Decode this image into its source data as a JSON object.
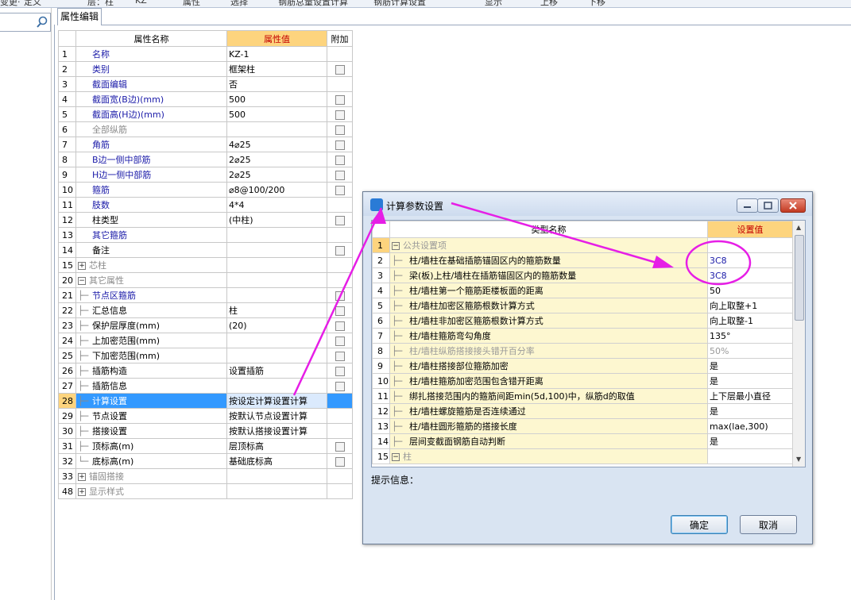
{
  "toolbar": {
    "items": [
      "变更·",
      "定义",
      "层：柱",
      "KZ",
      "属性",
      "选择",
      "钢筋总量设置计算",
      "钢筋计算设置",
      "显示",
      "上移",
      "下移"
    ]
  },
  "panel": {
    "tab_label": "属性编辑",
    "columns": {
      "name": "属性名称",
      "value": "属性值",
      "extra": "附加"
    },
    "rows": [
      {
        "num": "1",
        "name": "名称",
        "value": "KZ-1",
        "style": "blue",
        "check": false,
        "level": 0
      },
      {
        "num": "2",
        "name": "类别",
        "value": "框架柱",
        "style": "blue",
        "check": true,
        "level": 0
      },
      {
        "num": "3",
        "name": "截面编辑",
        "value": "否",
        "style": "blue",
        "check": false,
        "level": 0
      },
      {
        "num": "4",
        "name": "截面宽(B边)(mm)",
        "value": "500",
        "style": "blue",
        "check": true,
        "level": 0
      },
      {
        "num": "5",
        "name": "截面高(H边)(mm)",
        "value": "500",
        "style": "blue",
        "check": true,
        "level": 0
      },
      {
        "num": "6",
        "name": "全部纵筋",
        "value": "",
        "style": "gray",
        "check": true,
        "level": 0
      },
      {
        "num": "7",
        "name": "角筋",
        "value": "4⌀25",
        "style": "blue",
        "check": true,
        "level": 0
      },
      {
        "num": "8",
        "name": "B边一侧中部筋",
        "value": "2⌀25",
        "style": "blue",
        "check": true,
        "level": 0
      },
      {
        "num": "9",
        "name": "H边一侧中部筋",
        "value": "2⌀25",
        "style": "blue",
        "check": true,
        "level": 0
      },
      {
        "num": "10",
        "name": "箍筋",
        "value": "⌀8@100/200",
        "style": "blue",
        "check": true,
        "level": 0
      },
      {
        "num": "11",
        "name": "肢数",
        "value": "4*4",
        "style": "blue",
        "check": false,
        "level": 0
      },
      {
        "num": "12",
        "name": "柱类型",
        "value": "(中柱)",
        "style": "black",
        "check": true,
        "level": 0
      },
      {
        "num": "13",
        "name": "其它箍筋",
        "value": "",
        "style": "blue",
        "check": false,
        "level": 0
      },
      {
        "num": "14",
        "name": "备注",
        "value": "",
        "style": "black",
        "check": true,
        "level": 0
      },
      {
        "num": "15",
        "name": "芯柱",
        "value": "",
        "style": "gray",
        "check": false,
        "level": 0,
        "expander": "+"
      },
      {
        "num": "20",
        "name": "其它属性",
        "value": "",
        "style": "gray",
        "check": false,
        "level": 0,
        "expander": "−"
      },
      {
        "num": "21",
        "name": "节点区箍筋",
        "value": "",
        "style": "blue",
        "check": true,
        "level": 1
      },
      {
        "num": "22",
        "name": "汇总信息",
        "value": "柱",
        "style": "black",
        "check": true,
        "level": 1
      },
      {
        "num": "23",
        "name": "保护层厚度(mm)",
        "value": "(20)",
        "style": "black",
        "check": true,
        "level": 1
      },
      {
        "num": "24",
        "name": "上加密范围(mm)",
        "value": "",
        "style": "black",
        "check": true,
        "level": 1
      },
      {
        "num": "25",
        "name": "下加密范围(mm)",
        "value": "",
        "style": "black",
        "check": true,
        "level": 1
      },
      {
        "num": "26",
        "name": "插筋构造",
        "value": "设置插筋",
        "style": "black",
        "check": true,
        "level": 1
      },
      {
        "num": "27",
        "name": "插筋信息",
        "value": "",
        "style": "black",
        "check": true,
        "level": 1
      },
      {
        "num": "28",
        "name": "计算设置",
        "value": "按设定计算设置计算",
        "style": "black",
        "check": false,
        "level": 1,
        "selected": true
      },
      {
        "num": "29",
        "name": "节点设置",
        "value": "按默认节点设置计算",
        "style": "black",
        "check": false,
        "level": 1
      },
      {
        "num": "30",
        "name": "搭接设置",
        "value": "按默认搭接设置计算",
        "style": "black",
        "check": false,
        "level": 1
      },
      {
        "num": "31",
        "name": "顶标高(m)",
        "value": "层顶标高",
        "style": "black",
        "check": true,
        "level": 1
      },
      {
        "num": "32",
        "name": "底标高(m)",
        "value": "基础底标高",
        "style": "black",
        "check": true,
        "level": 1,
        "last": true
      },
      {
        "num": "33",
        "name": "锚固搭接",
        "value": "",
        "style": "gray",
        "check": false,
        "level": 0,
        "expander": "+"
      },
      {
        "num": "48",
        "name": "显示样式",
        "value": "",
        "style": "gray",
        "check": false,
        "level": 0,
        "expander": "+"
      }
    ]
  },
  "dialog": {
    "title": "计算参数设置",
    "columns": {
      "name": "类型名称",
      "setting": "设置值"
    },
    "rows": [
      {
        "num": "1",
        "name": "公共设置项",
        "value": "",
        "group": true,
        "gray": true
      },
      {
        "num": "2",
        "name": "柱/墙柱在基础插筋锚固区内的箍筋数量",
        "value": "3C8",
        "val_style": "blue"
      },
      {
        "num": "3",
        "name": "梁(板)上柱/墙柱在插筋锚固区内的箍筋数量",
        "value": "3C8",
        "val_style": "blue"
      },
      {
        "num": "4",
        "name": "柱/墙柱第一个箍筋距楼板面的距离",
        "value": "50"
      },
      {
        "num": "5",
        "name": "柱/墙柱加密区箍筋根数计算方式",
        "value": "向上取整+1"
      },
      {
        "num": "6",
        "name": "柱/墙柱非加密区箍筋根数计算方式",
        "value": "向上取整-1"
      },
      {
        "num": "7",
        "name": "柱/墙柱箍筋弯勾角度",
        "value": "135°"
      },
      {
        "num": "8",
        "name": "柱/墙柱纵筋搭接接头错开百分率",
        "value": "50%",
        "gray": true
      },
      {
        "num": "9",
        "name": "柱/墙柱搭接部位箍筋加密",
        "value": "是"
      },
      {
        "num": "10",
        "name": "柱/墙柱箍筋加密范围包含错开距离",
        "value": "是"
      },
      {
        "num": "11",
        "name": "绑扎搭接范围内的箍筋间距min(5d,100)中，纵筋d的取值",
        "value": "上下层最小直径"
      },
      {
        "num": "12",
        "name": "柱/墙柱螺旋箍筋是否连续通过",
        "value": "是"
      },
      {
        "num": "13",
        "name": "柱/墙柱圆形箍筋的搭接长度",
        "value": "max(lae,300)"
      },
      {
        "num": "14",
        "name": "层间变截面钢筋自动判断",
        "value": "是"
      },
      {
        "num": "15",
        "name": "柱",
        "value": "",
        "group": true,
        "gray": true
      }
    ],
    "hint_label": "提示信息：",
    "ok_label": "确定",
    "cancel_label": "取消"
  },
  "colors": {
    "header_accent": "#fdd47e",
    "header_text": "#c40000",
    "selected_row": "#3399ff",
    "annotation": "#e61ee6",
    "blue_value": "#1a1aa8"
  }
}
